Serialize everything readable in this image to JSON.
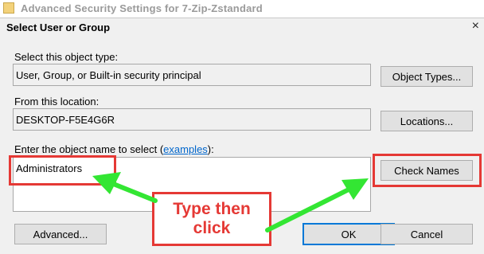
{
  "background_window": {
    "title": "Advanced Security Settings for 7-Zip-Zstandard"
  },
  "dialog": {
    "title": "Select User or Group",
    "close_glyph": "×",
    "object_type": {
      "label": "Select this object type:",
      "value": "User, Group, or Built-in security principal",
      "button": "Object Types..."
    },
    "location": {
      "label": "From this location:",
      "value": "DESKTOP-F5E4G6R",
      "button": "Locations..."
    },
    "object_names": {
      "label_before": "Enter the object name to select (",
      "label_link": "examples",
      "label_after": "):",
      "value": "Administrators",
      "check_button": "Check Names"
    },
    "footer": {
      "advanced_button": "Advanced...",
      "ok_button": "OK",
      "cancel_button": "Cancel"
    }
  },
  "annotation": {
    "callout_line1": "Type then",
    "callout_line2": "click",
    "highlight_color": "#e53935",
    "arrow_color": "#33e633"
  },
  "icons": {
    "app": "7zip-folder-icon",
    "close": "close-icon"
  }
}
